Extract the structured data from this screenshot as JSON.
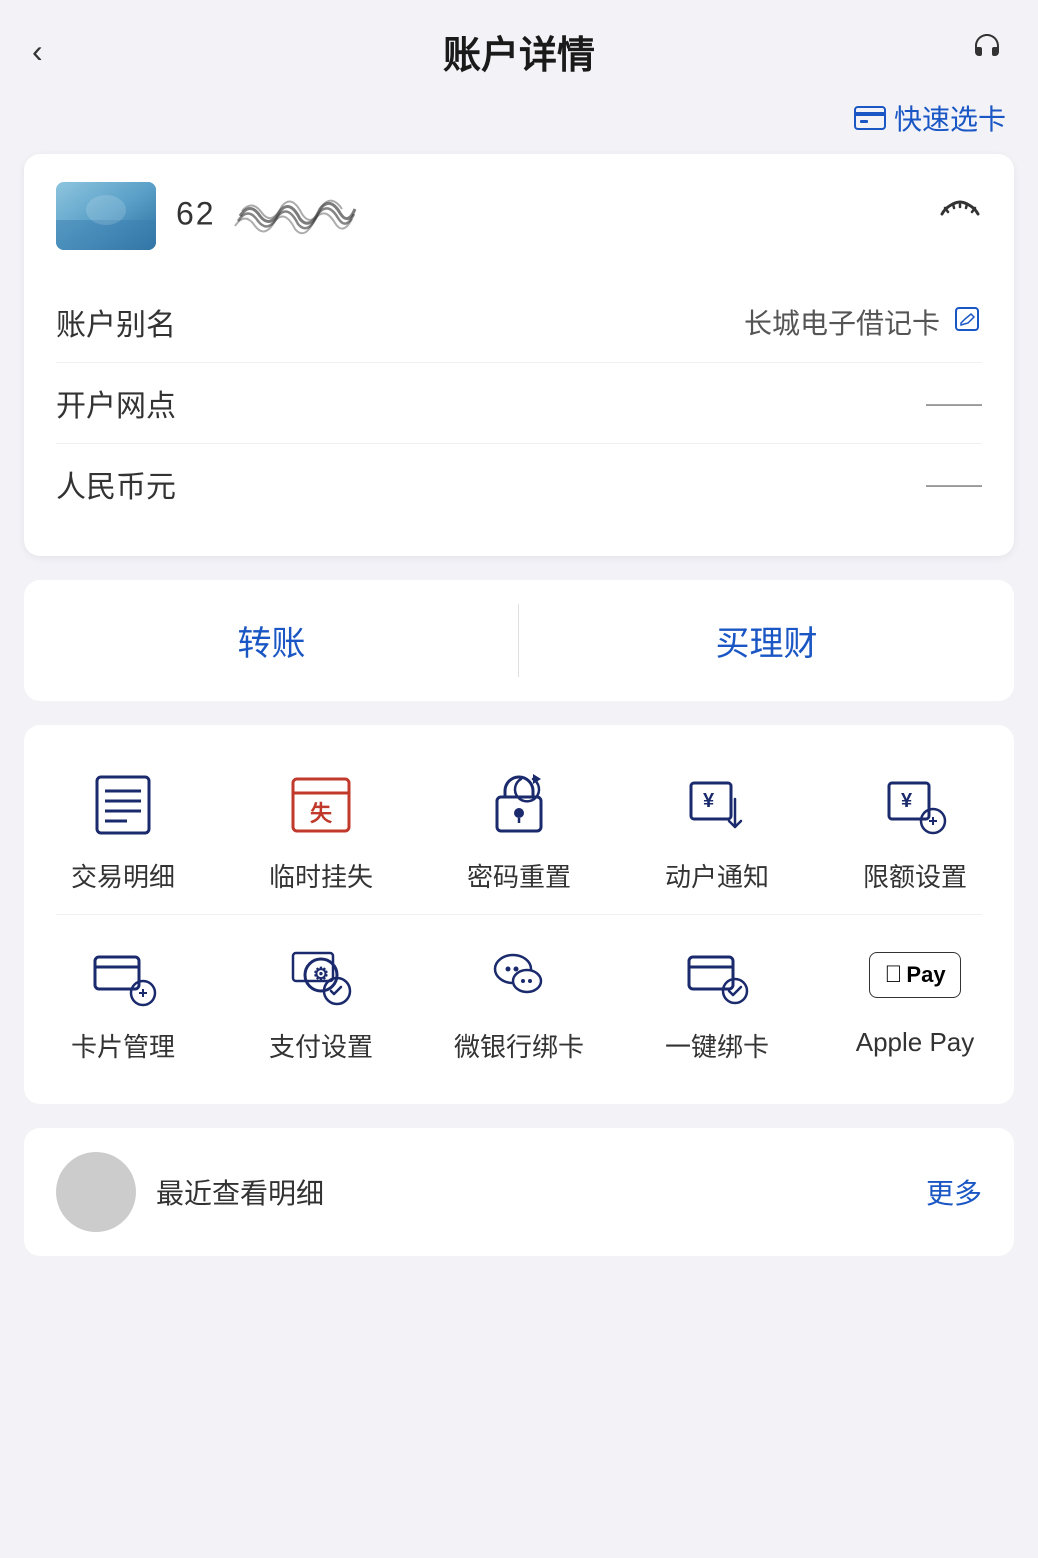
{
  "header": {
    "back_label": "‹",
    "title": "账户详情",
    "headset_icon": "🎧"
  },
  "quick_select": {
    "icon": "🪪",
    "label": "快速选卡"
  },
  "card": {
    "number_prefix": "62",
    "number_hidden": "····",
    "card_type": "长城电子借记卡",
    "alias_label": "账户别名",
    "branch_label": "开户网点",
    "branch_value": "——",
    "currency_label": "人民币元",
    "currency_value": "——"
  },
  "actions": {
    "transfer_label": "转账",
    "invest_label": "买理财"
  },
  "functions_row1": [
    {
      "id": "transaction",
      "label": "交易明细",
      "icon_type": "list"
    },
    {
      "id": "suspend",
      "label": "临时挂失",
      "icon_type": "lost"
    },
    {
      "id": "password",
      "label": "密码重置",
      "icon_type": "lock"
    },
    {
      "id": "notify",
      "label": "动户通知",
      "icon_type": "notify"
    },
    {
      "id": "limit",
      "label": "限额设置",
      "icon_type": "limit"
    }
  ],
  "functions_row2": [
    {
      "id": "card-mgr",
      "label": "卡片管理",
      "icon_type": "card-settings"
    },
    {
      "id": "pay-settings",
      "label": "支付设置",
      "icon_type": "pay-settings"
    },
    {
      "id": "wechat-bind",
      "label": "微银行绑卡",
      "icon_type": "wechat"
    },
    {
      "id": "bind-card",
      "label": "一键绑卡",
      "icon_type": "bind-card"
    },
    {
      "id": "apple-pay",
      "label": "Apple Pay",
      "icon_type": "apple-pay"
    }
  ],
  "bottom": {
    "text": "最近查看明细",
    "more_label": "更多"
  }
}
